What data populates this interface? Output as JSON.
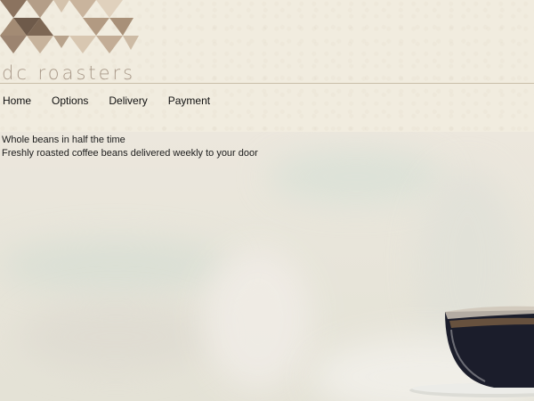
{
  "brand": {
    "name": "dc roasters"
  },
  "nav": {
    "items": [
      {
        "label": "Home"
      },
      {
        "label": "Options"
      },
      {
        "label": "Delivery"
      },
      {
        "label": "Payment"
      }
    ]
  },
  "hero": {
    "headline": "Whole beans in half the time",
    "subline": "Freshly roasted coffee beans delivered weekly to your door"
  },
  "colors": {
    "header_bg": "#f1ecdf",
    "logo_text": "#a89888",
    "logo_dark": "#6e5a4a",
    "logo_mid": "#a38b74",
    "logo_light": "#d4c3ad",
    "coffee": "#1b1d2b"
  }
}
